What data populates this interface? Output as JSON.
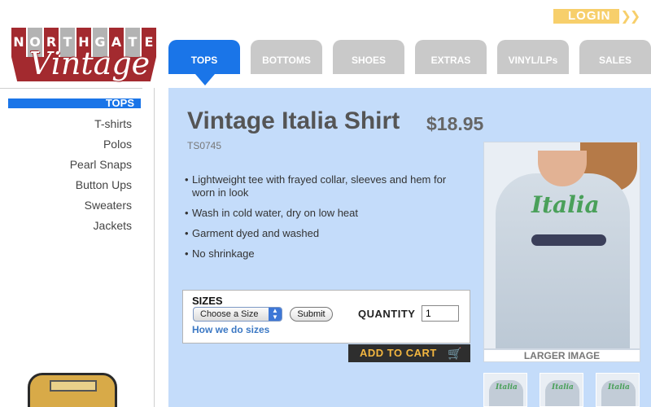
{
  "logo": {
    "letters": [
      "N",
      "O",
      "R",
      "T",
      "H",
      "G",
      "A",
      "T",
      "E"
    ],
    "script": "Vintage"
  },
  "login": {
    "label": "LOGIN",
    "arrows": "❯❯"
  },
  "tabs": [
    {
      "label": "TOPS",
      "active": true
    },
    {
      "label": "BOTTOMS",
      "active": false
    },
    {
      "label": "SHOES",
      "active": false
    },
    {
      "label": "EXTRAS",
      "active": false
    },
    {
      "label": "VINYL/LPs",
      "active": false
    },
    {
      "label": "SALES",
      "active": false
    }
  ],
  "sidebar": {
    "heading": "TOPS",
    "items": [
      "T-shirts",
      "Polos",
      "Pearl Snaps",
      "Button Ups",
      "Sweaters",
      "Jackets"
    ]
  },
  "product": {
    "title": "Vintage Italia Shirt",
    "price": "$18.95",
    "sku": "TS0745",
    "features": [
      "Lightweight tee with frayed collar, sleeves and hem for worn in look",
      "Wash in cold water, dry on low heat",
      "Garment dyed and washed",
      "No shrinkage"
    ],
    "image_text": "Italia",
    "larger_image_label": "LARGER IMAGE",
    "thumbnail_text": "Italia"
  },
  "sizes": {
    "label": "SIZES",
    "selected": "Choose a Size",
    "submit_label": "Submit",
    "help_link": "How we do sizes",
    "quantity_label": "QUANTITY",
    "quantity_value": "1"
  },
  "cart": {
    "label": "ADD TO CART"
  },
  "colors": {
    "brand_red": "#a32a2f",
    "tab_active": "#1a75e8",
    "tab_inactive": "#c9c9c9",
    "panel_bg": "#c4dcfa",
    "login_yellow": "#f7cf6b",
    "cart_text": "#f3b640"
  }
}
